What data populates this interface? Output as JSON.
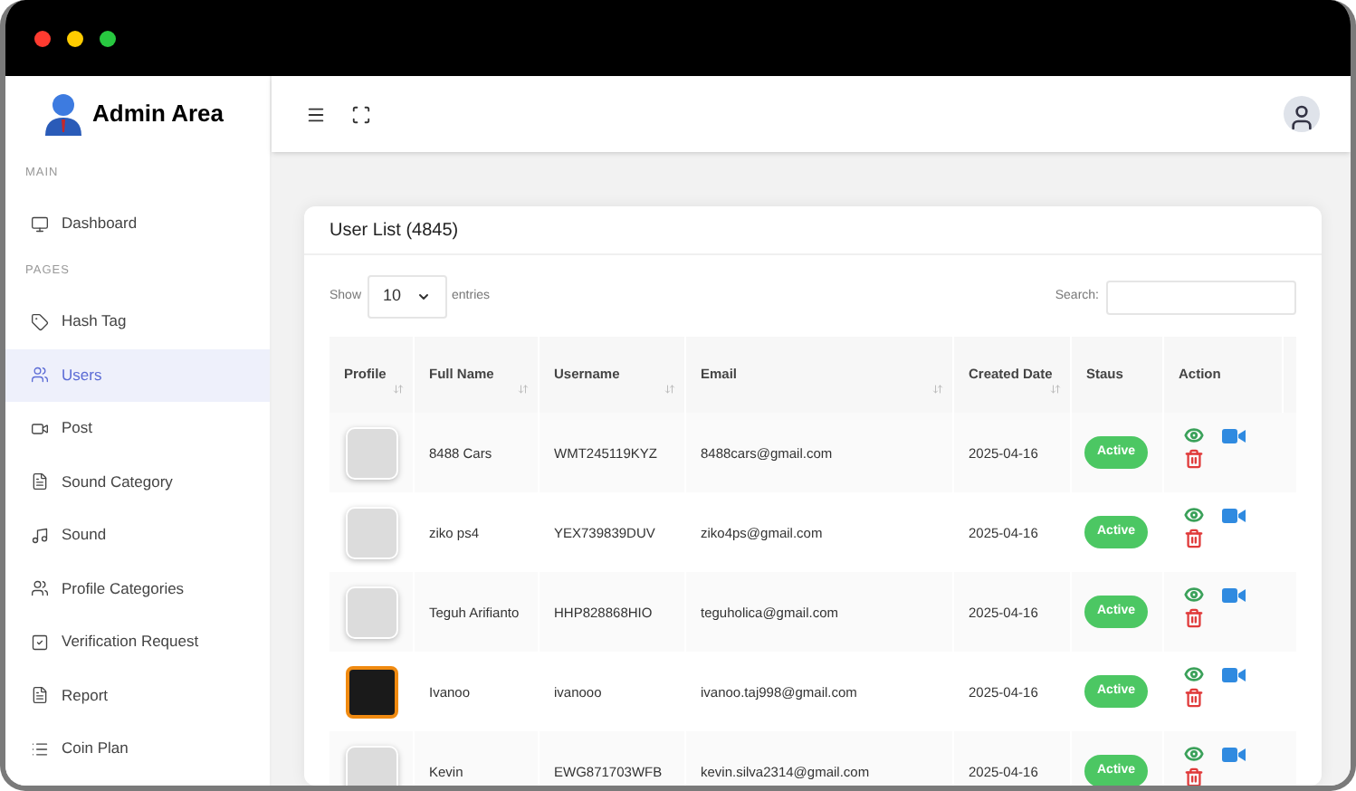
{
  "brand": {
    "title": "Admin Area"
  },
  "sidebar": {
    "sections": [
      {
        "heading": "MAIN",
        "items": [
          {
            "label": "Dashboard",
            "kind": "monitor",
            "selected": false
          }
        ]
      },
      {
        "heading": "PAGES",
        "items": [
          {
            "label": "Hash Tag",
            "kind": "tag",
            "selected": false
          },
          {
            "label": "Users",
            "kind": "users",
            "selected": true
          },
          {
            "label": "Post",
            "kind": "video",
            "selected": false
          },
          {
            "label": "Sound Category",
            "kind": "file",
            "selected": false
          },
          {
            "label": "Sound",
            "kind": "music",
            "selected": false
          },
          {
            "label": "Profile Categories",
            "kind": "users",
            "selected": false
          },
          {
            "label": "Verification Request",
            "kind": "check",
            "selected": false
          },
          {
            "label": "Report",
            "kind": "file",
            "selected": false
          },
          {
            "label": "Coin Plan",
            "kind": "list",
            "selected": false
          }
        ]
      }
    ]
  },
  "card": {
    "title": "User List (4845)",
    "show_label": "Show",
    "page_size": "10",
    "entries_label": "entries",
    "search_label": "Search:"
  },
  "table": {
    "columns": [
      {
        "label": "Profile",
        "sortable": true
      },
      {
        "label": "Full Name",
        "sortable": true
      },
      {
        "label": "Username",
        "sortable": true
      },
      {
        "label": "Email",
        "sortable": true
      },
      {
        "label": "Created Date",
        "sortable": true
      },
      {
        "label": "Staus",
        "sortable": false
      },
      {
        "label": "Action",
        "sortable": false
      }
    ],
    "rows": [
      {
        "kind": "placeholder",
        "full_name": "8488 Cars",
        "username": "WMT245119KYZ",
        "email": "8488cars@gmail.com",
        "created": "2025-04-16",
        "status": "Active"
      },
      {
        "kind": "placeholder",
        "full_name": "ziko ps4",
        "username": "YEX739839DUV",
        "email": "ziko4ps@gmail.com",
        "created": "2025-04-16",
        "status": "Active"
      },
      {
        "kind": "placeholder",
        "full_name": "Teguh Arifianto",
        "username": "HHP828868HIO",
        "email": "teguholica@gmail.com",
        "created": "2025-04-16",
        "status": "Active"
      },
      {
        "kind": "photo",
        "full_name": "Ivanoo",
        "username": "ivanooo",
        "email": "ivanoo.taj998@gmail.com",
        "created": "2025-04-16",
        "status": "Active"
      },
      {
        "kind": "placeholder",
        "full_name": "Kevin",
        "username": "EWG871703WFB",
        "email": "kevin.silva2314@gmail.com",
        "created": "2025-04-16",
        "status": "Active"
      }
    ]
  }
}
